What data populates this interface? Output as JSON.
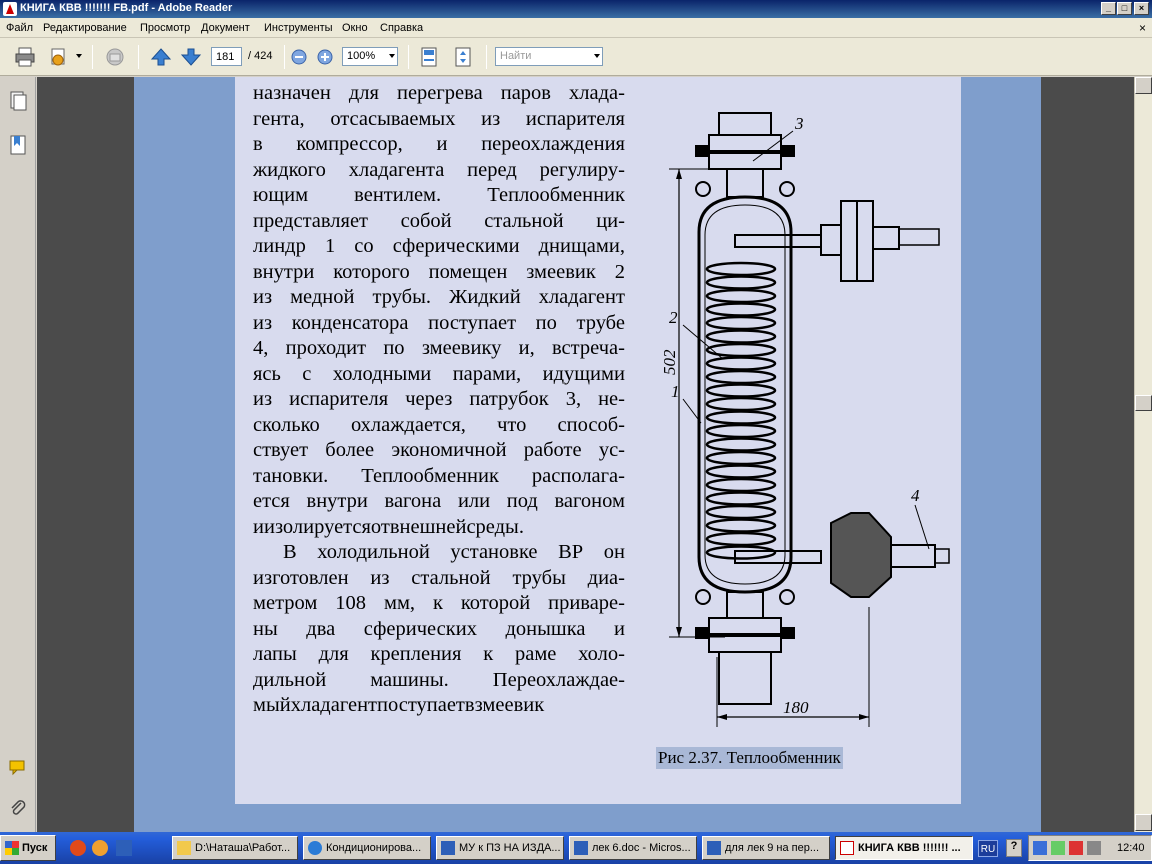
{
  "window": {
    "title": "КНИГА КВВ !!!!!!! FB.pdf - Adobe Reader"
  },
  "menu": [
    "Файл",
    "Редактирование",
    "Просмотр",
    "Документ",
    "Инструменты",
    "Окно",
    "Справка"
  ],
  "toolbar": {
    "page_current": "181",
    "page_total": "/ 424",
    "zoom": "100%",
    "search_placeholder": "Найти"
  },
  "document": {
    "lines": [
      "назначен для перегрева паров хлада-",
      "гента, отсасываемых из испарителя",
      "в компрессор, и переохлаждения",
      "жидкого хладагента перед регулиру-",
      "ющим вентилем. Теплообменник",
      "представляет собой стальной ци-",
      "линдр 1 со сферическими днищами,",
      "внутри которого помещен змеевик 2",
      "из медной трубы. Жидкий хладагент",
      "из конденсатора поступает по трубе",
      "4, проходит по змеевику и, встреча-",
      "ясь с холодными парами, идущими",
      "из испарителя через патрубок 3, не-",
      "сколько охлаждается, что способ-",
      "ствует более экономичной работе ус-",
      "тановки. Теплообменник располага-",
      "ется внутри вагона или под вагоном",
      "и изолируется от внешней среды.",
      "В холодильной установке ВР он",
      "изготовлен из стальной трубы диа-",
      "метром 108 мм, к которой приваре-",
      "ны два сферических донышка и",
      "лапы для крепления к раме холо-",
      "дильной машины. Переохлаждае-",
      "мый хладагент поступает в змеевик"
    ],
    "figure": {
      "label_1": "1",
      "label_2": "2",
      "label_3": "3",
      "label_4": "4",
      "dim_height": "502",
      "dim_width": "180"
    },
    "caption": "Рис 2.37. Теплообменник"
  },
  "taskbar": {
    "start": "Пуск",
    "tasks": [
      "D:\\Наташа\\Работ...",
      "Кондиционирова...",
      "МУ к ПЗ НА ИЗДА...",
      "лек 6.doc - Micros...",
      "для лек 9 на пер...",
      "КНИГА КВВ !!!!!!! ..."
    ],
    "lang": "RU",
    "clock": "12:40"
  }
}
